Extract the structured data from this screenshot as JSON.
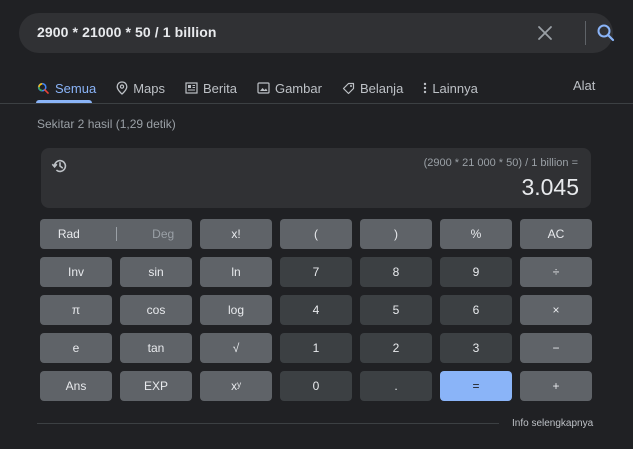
{
  "search": {
    "query": "2900 * 21000 * 50 / 1 billion",
    "clear_icon": "close-icon",
    "search_icon": "search-icon"
  },
  "tabs": [
    {
      "label": "Semua",
      "icon": "search-icon",
      "active": true
    },
    {
      "label": "Maps",
      "icon": "map-pin-icon",
      "active": false
    },
    {
      "label": "Berita",
      "icon": "newspaper-icon",
      "active": false
    },
    {
      "label": "Gambar",
      "icon": "image-icon",
      "active": false
    },
    {
      "label": "Belanja",
      "icon": "tag-icon",
      "active": false
    },
    {
      "label": "Lainnya",
      "icon": "more-vert-icon",
      "active": false
    }
  ],
  "tools_label": "Alat",
  "result_stats": "Sekitar 2 hasil (1,29 detik)",
  "calculator": {
    "expression": "(2900 * 21 000 * 50) / 1 billion =",
    "result": "3.045",
    "mode": {
      "rad": "Rad",
      "deg": "Deg",
      "active": "Rad"
    },
    "keys": [
      [
        "x!",
        "(",
        ")",
        "%",
        "AC"
      ],
      [
        "Inv",
        "sin",
        "ln",
        "7",
        "8",
        "9",
        "÷"
      ],
      [
        "π",
        "cos",
        "log",
        "4",
        "5",
        "6",
        "×"
      ],
      [
        "e",
        "tan",
        "√",
        "1",
        "2",
        "3",
        "−"
      ],
      [
        "Ans",
        "EXP",
        "xʸ",
        "0",
        ".",
        "=",
        "+"
      ]
    ]
  },
  "more_info": "Info selengkapnya",
  "colors": {
    "background": "#202124",
    "accent": "#8ab4f8",
    "key_function": "#5f6368",
    "key_number": "#3c4043"
  }
}
